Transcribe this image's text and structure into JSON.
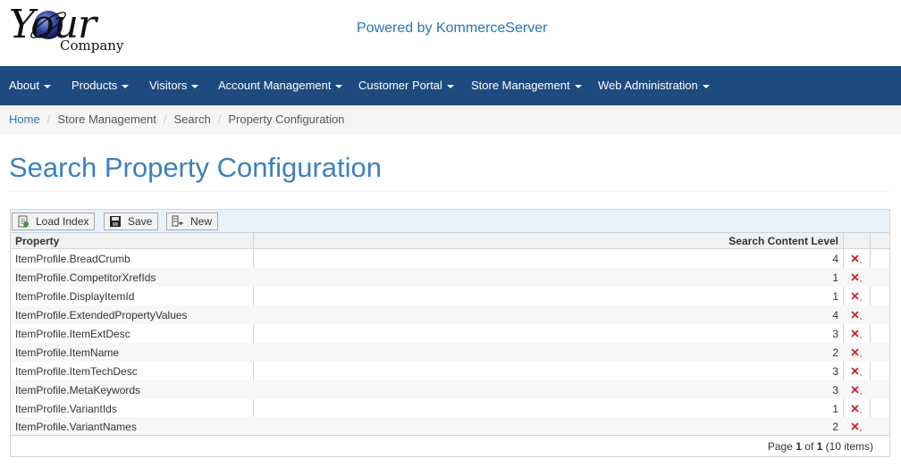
{
  "logo": {
    "brand": "Your",
    "company": "Company"
  },
  "header": {
    "powered_by": "Powered by KommerceServer"
  },
  "nav": [
    {
      "label": "About"
    },
    {
      "label": "Products"
    },
    {
      "label": "Visitors"
    },
    {
      "label": "Account Management"
    },
    {
      "label": "Customer Portal"
    },
    {
      "label": "Store Management"
    },
    {
      "label": "Web Administration"
    }
  ],
  "breadcrumb": [
    "Home",
    "Store Management",
    "Search",
    "Property Configuration"
  ],
  "page": {
    "title": "Search Property Configuration"
  },
  "toolbar": {
    "load_index": "Load Index",
    "save": "Save",
    "new": "New"
  },
  "table": {
    "columns": [
      "Property",
      "Search Content Level"
    ],
    "rows": [
      {
        "property": "ItemProfile.BreadCrumb",
        "level": "4"
      },
      {
        "property": "ItemProfile.CompetitorXrefIds",
        "level": "1"
      },
      {
        "property": "ItemProfile.DisplayItemId",
        "level": "1"
      },
      {
        "property": "ItemProfile.ExtendedPropertyValues",
        "level": "4"
      },
      {
        "property": "ItemProfile.ItemExtDesc",
        "level": "3"
      },
      {
        "property": "ItemProfile.ItemName",
        "level": "2"
      },
      {
        "property": "ItemProfile.ItemTechDesc",
        "level": "3"
      },
      {
        "property": "ItemProfile.MetaKeywords",
        "level": "3"
      },
      {
        "property": "ItemProfile.VariantIds",
        "level": "1"
      },
      {
        "property": "ItemProfile.VariantNames",
        "level": "2"
      }
    ]
  },
  "pager": {
    "prefix": "Page",
    "page": "1",
    "of": "of",
    "total_pages": "1",
    "items": "(10 items)"
  },
  "colors": {
    "navbar": "#1e4a80",
    "title": "#3c82bd",
    "link": "#2a72b5",
    "delete": "#cc2222"
  }
}
